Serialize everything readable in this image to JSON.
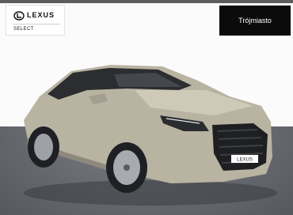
{
  "brand": {
    "wordmark": "LEXUS",
    "program": "SELECT",
    "logo_icon": "lexus-emblem-icon"
  },
  "location": {
    "label": "Trójmiasto"
  },
  "photo": {
    "subject": "car-photo",
    "plate_text": "LEXUS"
  },
  "colors": {
    "location_bg": "#0b0b0b",
    "location_text": "#ffffff",
    "car_body": "#b9b3a2",
    "floor": "#6d7076"
  }
}
